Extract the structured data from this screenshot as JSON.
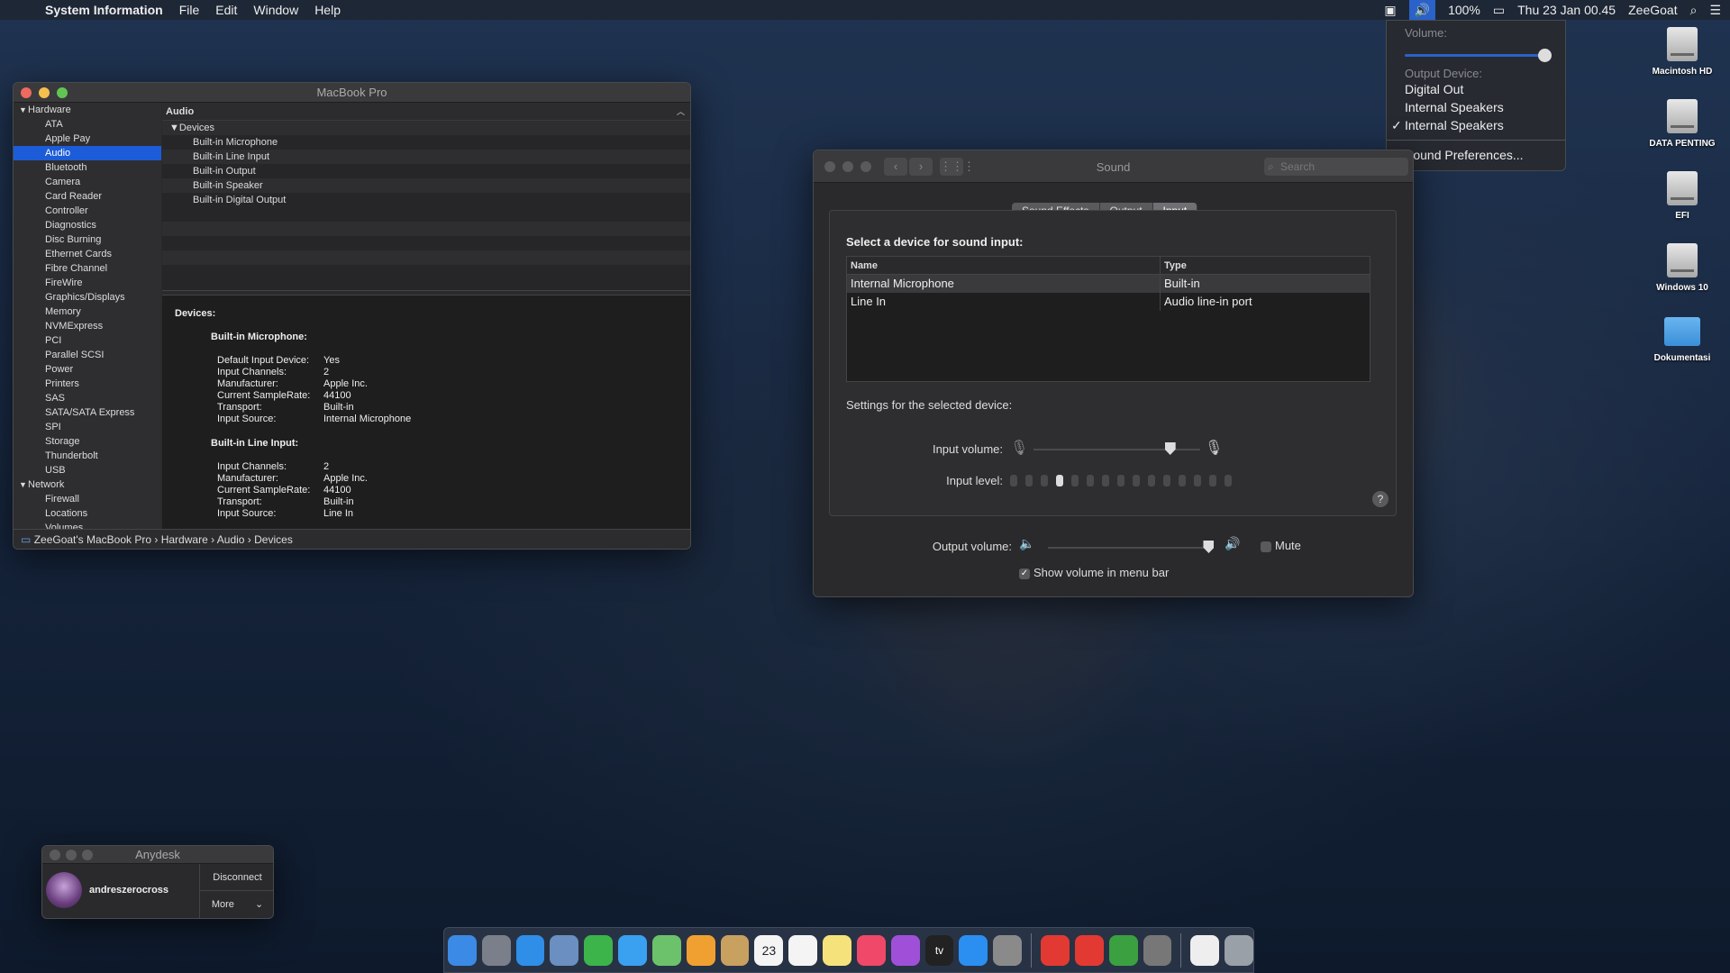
{
  "menubar": {
    "app_name": "System Information",
    "menus": [
      "File",
      "Edit",
      "Window",
      "Help"
    ],
    "battery": "100%",
    "datetime": "Thu 23 Jan  00.45",
    "user": "ZeeGoat"
  },
  "volume_menu": {
    "volume_label": "Volume:",
    "volume_level": 0.97,
    "output_label": "Output Device:",
    "devices": [
      "Digital Out",
      "Internal Speakers",
      "Internal Speakers"
    ],
    "checked_index": 2,
    "prefs": "Sound Preferences..."
  },
  "desktop_icons": [
    "Macintosh HD",
    "DATA PENTING",
    "EFI",
    "Windows 10",
    "Dokumentasi"
  ],
  "sysinfo": {
    "title": "MacBook Pro",
    "sidebar": {
      "hardware": "Hardware",
      "hardware_items": [
        "ATA",
        "Apple Pay",
        "Audio",
        "Bluetooth",
        "Camera",
        "Card Reader",
        "Controller",
        "Diagnostics",
        "Disc Burning",
        "Ethernet Cards",
        "Fibre Channel",
        "FireWire",
        "Graphics/Displays",
        "Memory",
        "NVMExpress",
        "PCI",
        "Parallel SCSI",
        "Power",
        "Printers",
        "SAS",
        "SATA/SATA Express",
        "SPI",
        "Storage",
        "Thunderbolt",
        "USB"
      ],
      "selected": "Audio",
      "network": "Network",
      "network_items": [
        "Firewall",
        "Locations",
        "Volumes"
      ]
    },
    "table_header": "Audio",
    "group": "Devices",
    "devices": [
      "Built-in Microphone",
      "Built-in Line Input",
      "Built-in Output",
      "Built-in Speaker",
      "Built-in Digital Output"
    ],
    "detail_title": "Devices:",
    "mic_title": "Built-in Microphone:",
    "mic_props": [
      [
        "Default Input Device:",
        "Yes"
      ],
      [
        "Input Channels:",
        "2"
      ],
      [
        "Manufacturer:",
        "Apple Inc."
      ],
      [
        "Current SampleRate:",
        "44100"
      ],
      [
        "Transport:",
        "Built-in"
      ],
      [
        "Input Source:",
        "Internal Microphone"
      ]
    ],
    "line_title": "Built-in Line Input:",
    "line_props": [
      [
        "Input Channels:",
        "2"
      ],
      [
        "Manufacturer:",
        "Apple Inc."
      ],
      [
        "Current SampleRate:",
        "44100"
      ],
      [
        "Transport:",
        "Built-in"
      ],
      [
        "Input Source:",
        "Line In"
      ]
    ],
    "path": [
      "ZeeGoat's MacBook Pro",
      "Hardware",
      "Audio",
      "Devices"
    ]
  },
  "sound": {
    "title": "Sound",
    "search_placeholder": "Search",
    "tabs": [
      "Sound Effects",
      "Output",
      "Input"
    ],
    "select_heading": "Select a device for sound input:",
    "col_name": "Name",
    "col_type": "Type",
    "rows": [
      [
        "Internal Microphone",
        "Built-in"
      ],
      [
        "Line In",
        "Audio line-in port"
      ]
    ],
    "settings_heading": "Settings for the selected device:",
    "input_volume_label": "Input volume:",
    "input_volume": 0.82,
    "input_level_label": "Input level:",
    "input_level_bars": 15,
    "input_level_on": 4,
    "help": "?",
    "output_volume_label": "Output volume:",
    "output_volume": 0.97,
    "mute_label": "Mute",
    "show_volume_label": "Show volume in menu bar"
  },
  "anydesk": {
    "title": "Anydesk",
    "user": "andreszerocross",
    "disconnect": "Disconnect",
    "more": "More"
  },
  "dock": {
    "apps": [
      "finder-icon",
      "launchpad-icon",
      "safari-icon",
      "preview-icon",
      "facetime-icon",
      "messages-icon",
      "maps-icon",
      "photos-icon",
      "notes-icon",
      "calendar-icon",
      "reminders-icon",
      "stickies-icon",
      "music-icon",
      "podcasts-icon",
      "tv-icon",
      "appstore-icon",
      "system-preferences-icon",
      "anydesk-icon",
      "anydesk-icon-2",
      "network-icon",
      "audio-midi-icon",
      "document-icon",
      "trash-icon"
    ],
    "calendar_day": "23",
    "tv_label": "tv"
  }
}
